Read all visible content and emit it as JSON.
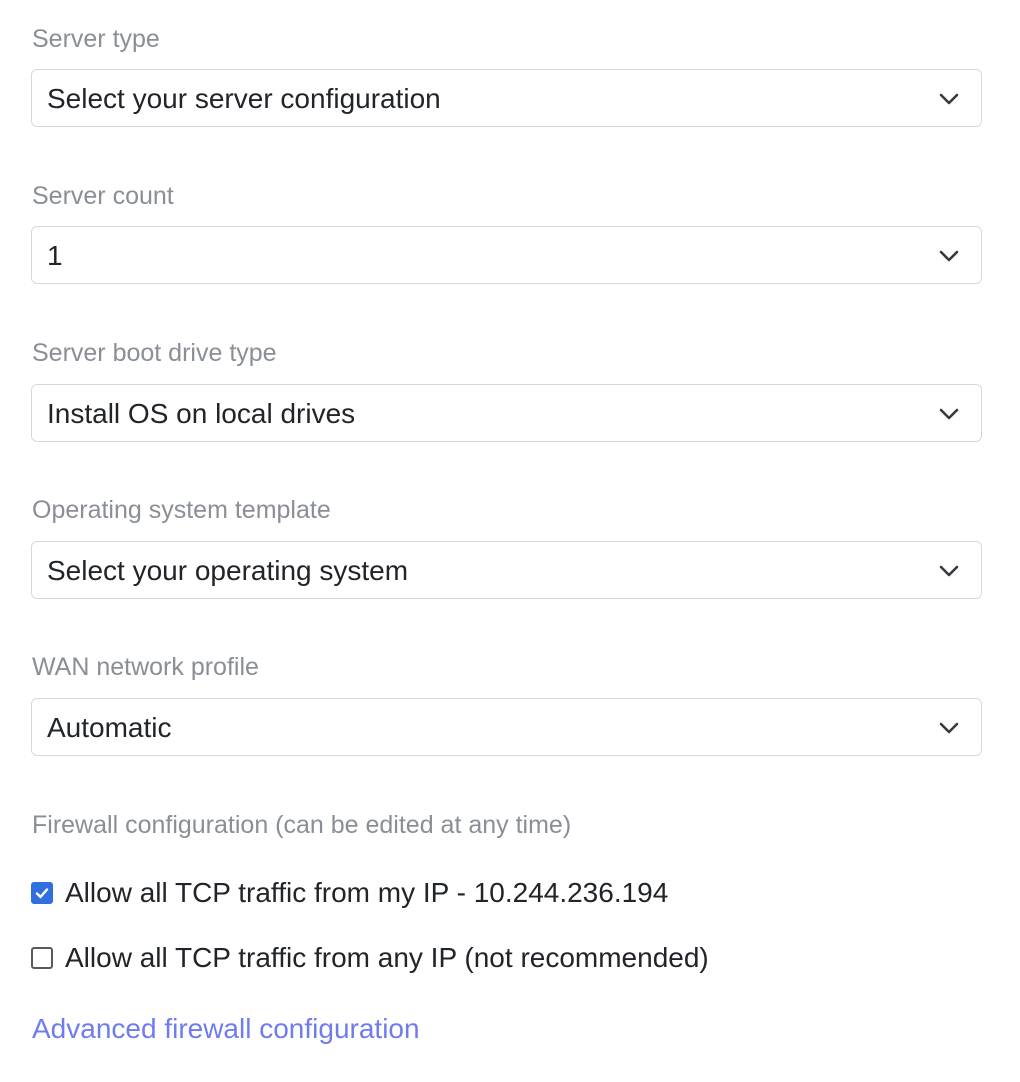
{
  "form": {
    "server_type": {
      "label": "Server type",
      "value": "Select your server configuration",
      "icon": "chevron-down-icon"
    },
    "server_count": {
      "label": "Server count",
      "value": "1",
      "icon": "chevron-down-icon"
    },
    "boot_drive": {
      "label": "Server boot drive type",
      "value": "Install OS on local drives",
      "icon": "chevron-down-icon"
    },
    "os_template": {
      "label": "Operating system template",
      "value": "Select your operating system",
      "icon": "chevron-down-icon"
    },
    "wan_profile": {
      "label": "WAN network profile",
      "value": "Automatic",
      "icon": "chevron-down-icon"
    },
    "firewall": {
      "label": "Firewall configuration (can be edited at any time)",
      "options": [
        {
          "label": "Allow all TCP traffic from my IP - 10.244.236.194",
          "checked": true
        },
        {
          "label": "Allow all TCP traffic from any IP (not recommended)",
          "checked": false
        }
      ],
      "advanced_link": "Advanced firewall configuration"
    }
  },
  "colors": {
    "label_text": "#8a8f96",
    "link": "#6f7cf0",
    "checkbox_checked": "#2f6fe0",
    "border": "#d6d9dc"
  }
}
